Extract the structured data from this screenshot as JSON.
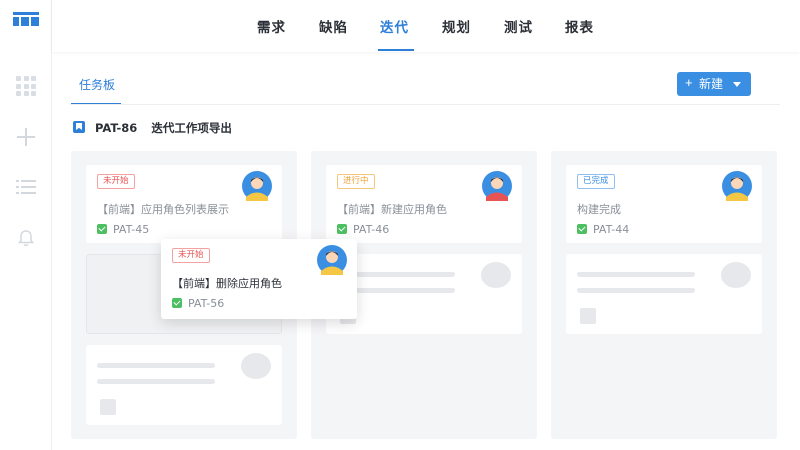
{
  "nav": {
    "tabs": [
      "需求",
      "缺陷",
      "迭代",
      "规划",
      "测试",
      "报表"
    ],
    "active_tab": "迭代"
  },
  "subheader": {
    "tab_label": "任务板",
    "new_button_label": "新建"
  },
  "iteration": {
    "id": "PAT-86",
    "title": "迭代工作项导出"
  },
  "columns": [
    {
      "cards": [
        {
          "status": "未开始",
          "title": "【前端】应用角色列表展示",
          "id": "PAT-45",
          "avatar": "user-avatar"
        }
      ]
    },
    {
      "cards": [
        {
          "status": "进行中",
          "title": "【前端】新建应用角色",
          "id": "PAT-46",
          "avatar": "user-avatar"
        }
      ]
    },
    {
      "cards": [
        {
          "status": "已完成",
          "title": "构建完成",
          "id": "PAT-44",
          "avatar": "user-avatar"
        }
      ]
    }
  ],
  "dragged_card": {
    "status": "未开始",
    "title": "【前端】删除应用角色",
    "id": "PAT-56",
    "avatar": "user-avatar"
  },
  "colors": {
    "accent": "#2d7fd8",
    "status_not_started": "#e85454",
    "status_in_progress": "#f2a33a",
    "status_done": "#3b8fe3",
    "check_green": "#4cbf62"
  }
}
